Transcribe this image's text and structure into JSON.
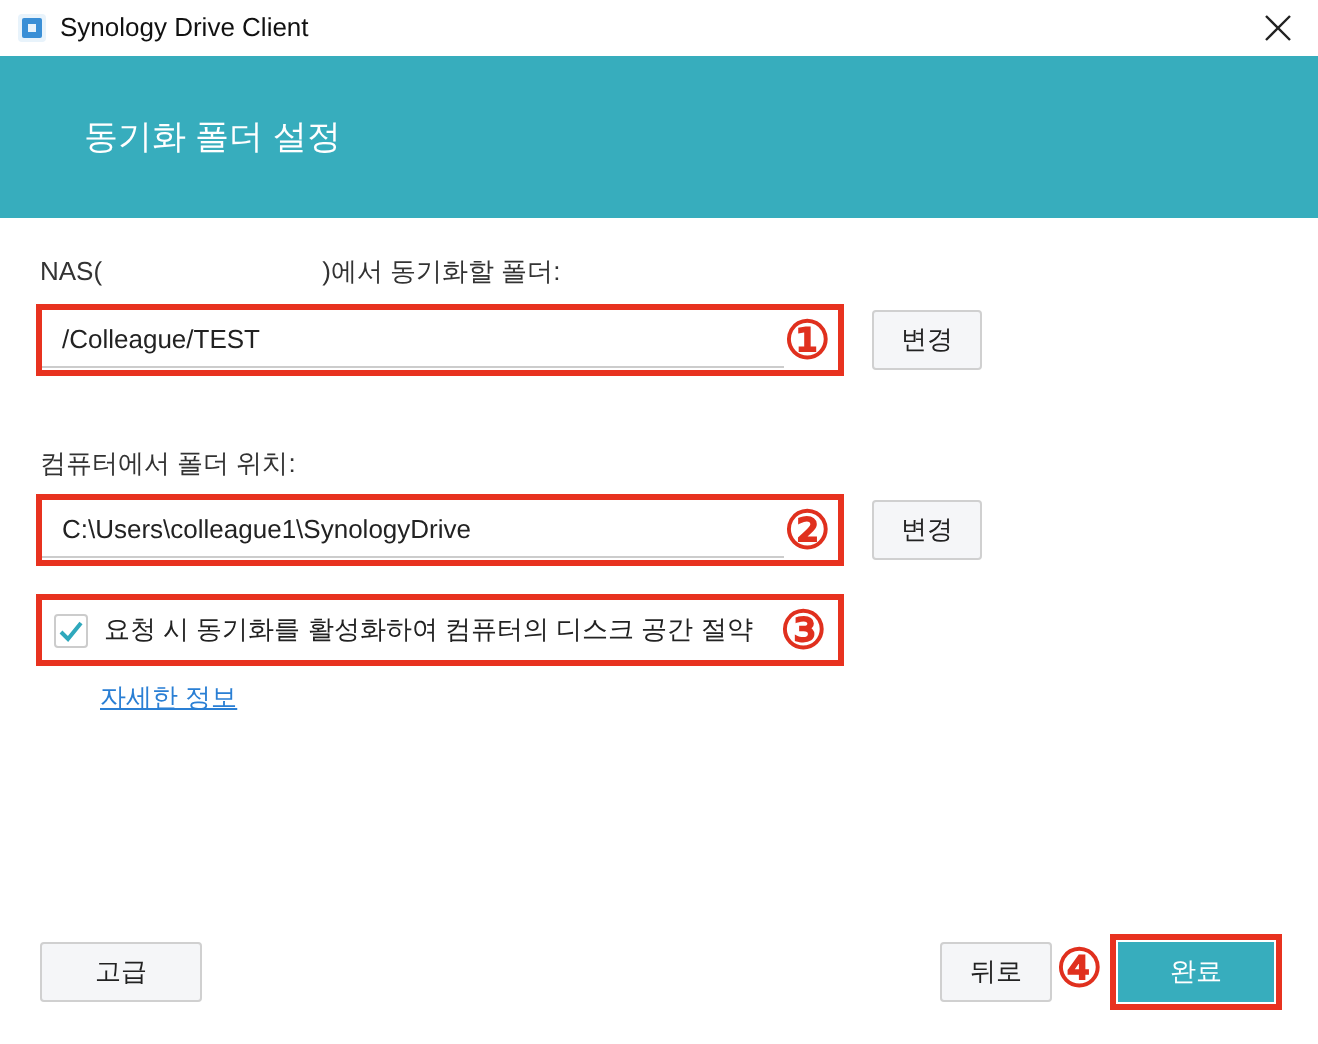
{
  "window": {
    "title": "Synology Drive Client"
  },
  "header": {
    "title": "동기화 폴더 설정"
  },
  "nas_folder": {
    "label_start": "NAS(",
    "label_end": ")에서 동기화할 폴더:",
    "value": "/Colleague/TEST",
    "marker": "①",
    "button": "변경"
  },
  "local_folder": {
    "label": "컴퓨터에서 폴더 위치:",
    "value": "C:\\Users\\colleague1\\SynologyDrive",
    "marker": "②",
    "button": "변경"
  },
  "on_demand": {
    "label": "요청 시 동기화를 활성화하여 컴퓨터의 디스크 공간 절약",
    "checked": true,
    "marker": "③"
  },
  "more_info_link": "자세한 정보",
  "footer": {
    "advanced_button": "고급",
    "back_button": "뒤로",
    "marker": "④",
    "finish_button": "완료"
  }
}
